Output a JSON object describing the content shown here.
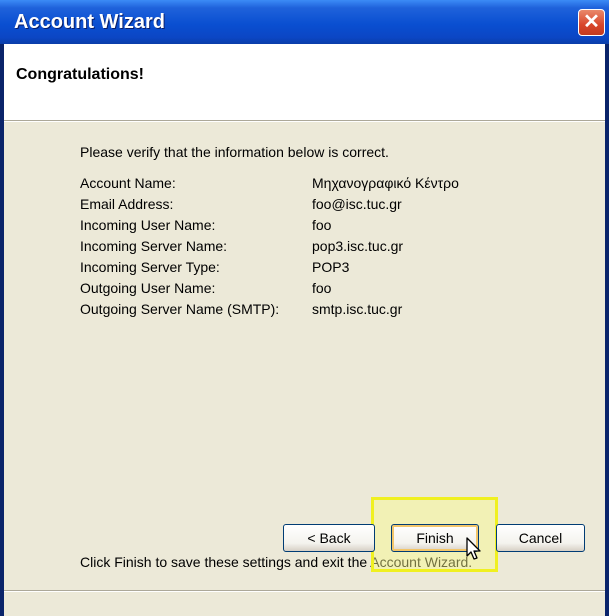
{
  "window": {
    "title": "Account Wizard",
    "close_glyph": "✕"
  },
  "header": {
    "heading": "Congratulations!"
  },
  "content": {
    "intro": "Please verify that the information below is correct.",
    "rows": [
      {
        "label": "Account Name:",
        "value": "Μηχανογραφικό Κέντρο"
      },
      {
        "label": "Email Address:",
        "value": "foo@isc.tuc.gr"
      },
      {
        "label": "Incoming User Name:",
        "value": "foo"
      },
      {
        "label": "Incoming Server Name:",
        "value": "pop3.isc.tuc.gr"
      },
      {
        "label": "Incoming Server Type:",
        "value": "POP3"
      },
      {
        "label": "Outgoing User Name:",
        "value": "foo"
      },
      {
        "label": "Outgoing Server Name (SMTP):",
        "value": "smtp.isc.tuc.gr"
      }
    ],
    "finish_note": "Click Finish to save these settings and exit the Account Wizard."
  },
  "buttons": {
    "back": "< Back",
    "finish": "Finish",
    "cancel": "Cancel"
  },
  "icons": {
    "close": "close-icon",
    "cursor": "mouse-pointer-icon"
  },
  "colors": {
    "titlebar": "#0a4fd1",
    "frame": "#ece9d8",
    "highlight": "#f0f020"
  }
}
